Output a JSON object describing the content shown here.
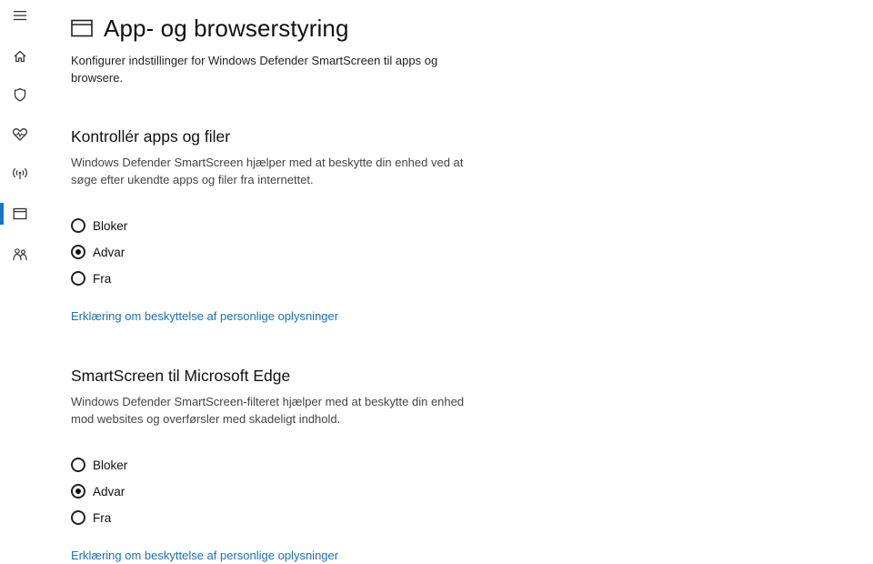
{
  "nav": {
    "items": [
      {
        "icon": "hamburger-menu-icon"
      },
      {
        "icon": "home-icon"
      },
      {
        "icon": "shield-icon"
      },
      {
        "icon": "heart-health-icon"
      },
      {
        "icon": "network-antenna-icon"
      },
      {
        "icon": "app-browser-window-icon",
        "active": true
      },
      {
        "icon": "family-icon"
      }
    ],
    "accent": "#1a73c8"
  },
  "page": {
    "title": "App- og browserstyring",
    "description": "Konfigurer indstillinger for Windows Defender SmartScreen til apps og browsere."
  },
  "sections": [
    {
      "title": "Kontrollér apps og filer",
      "description": "Windows Defender SmartScreen hjælper med at beskytte din enhed ved at søge efter ukendte apps og filer fra internettet.",
      "options": [
        {
          "label": "Bloker",
          "checked": false
        },
        {
          "label": "Advar",
          "checked": true
        },
        {
          "label": "Fra",
          "checked": false
        }
      ],
      "link": "Erklæring om beskyttelse af personlige oplysninger"
    },
    {
      "title": "SmartScreen til Microsoft Edge",
      "description": "Windows Defender SmartScreen-filteret hjælper med at beskytte din enhed mod websites og overførsler med skadeligt indhold.",
      "options": [
        {
          "label": "Bloker",
          "checked": false
        },
        {
          "label": "Advar",
          "checked": true
        },
        {
          "label": "Fra",
          "checked": false
        }
      ],
      "link": "Erklæring om beskyttelse af personlige oplysninger"
    }
  ],
  "colors": {
    "link": "#1a6fc4",
    "text": "#111111",
    "muted": "#444444"
  }
}
